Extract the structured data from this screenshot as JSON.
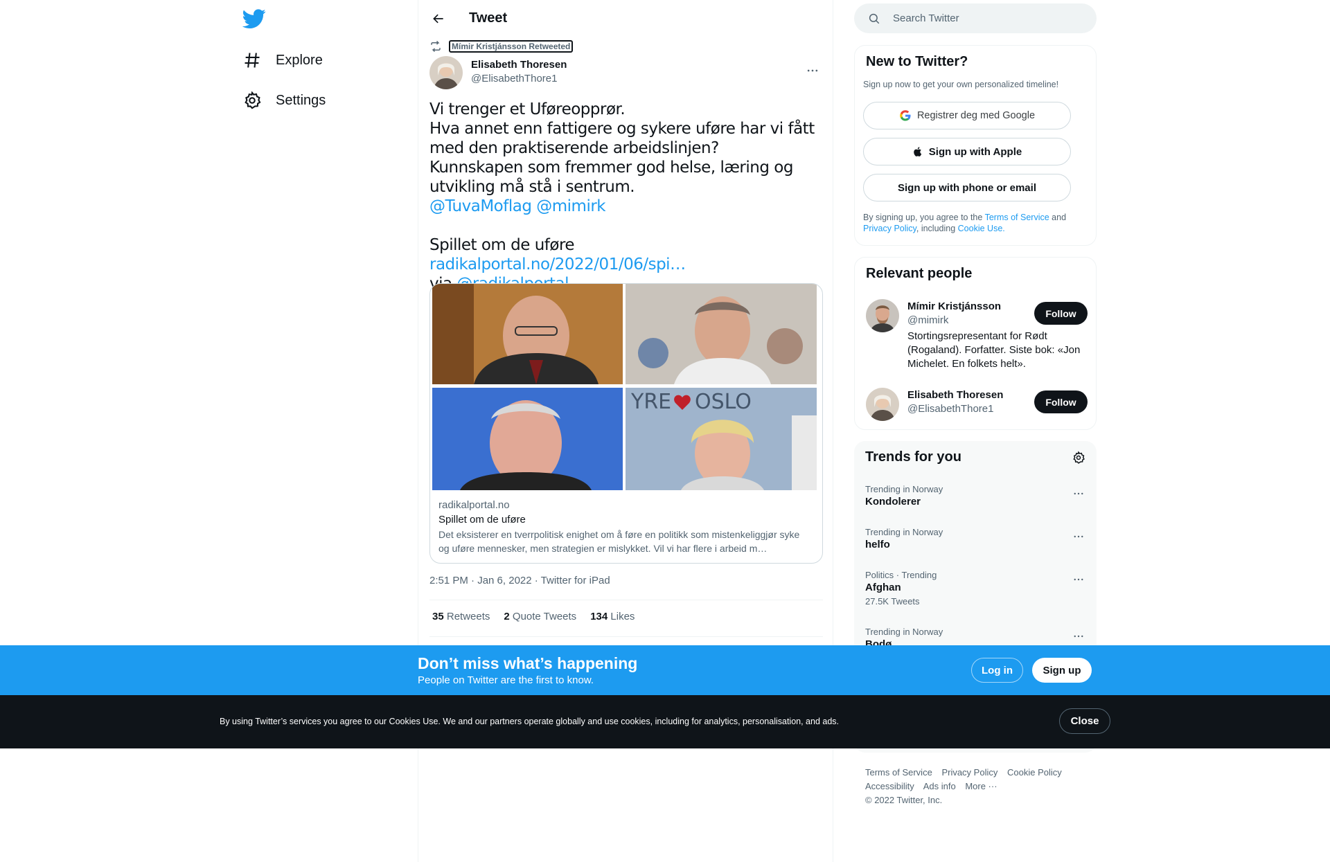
{
  "nav": {
    "items": [
      {
        "label": "Explore",
        "icon": "hashtag-icon"
      },
      {
        "label": "Settings",
        "icon": "gear-icon"
      }
    ]
  },
  "header": {
    "title": "Tweet"
  },
  "tweet": {
    "retweeted_by": "Mímir Kristjánsson Retweeted",
    "author_name": "Elisabeth Thoresen",
    "author_handle": "@ElisabethThore1",
    "text_line1": "Vi trenger et Uføreopprør.",
    "text_line2": "Hva annet enn fattigere og sykere uføre har vi fått med den praktiserende arbeidslinjen?",
    "text_line3": "Kunnskapen som fremmer god helse, læring og utvikling må stå i sentrum.",
    "mention1": "@TuvaMoflag",
    "mention2": "@mimirk",
    "text_article": "Spillet om de uføre",
    "link": "radikalportal.no/2022/01/06/spi…",
    "via": "via",
    "mention3": "@radikalportal",
    "card": {
      "domain": "radikalportal.no",
      "title": "Spillet om de uføre",
      "description": "Det eksisterer en tverrpolitisk enighet om å føre en politikk som mistenkeliggjør syke og uføre mennesker, men strategien er mislykket. Vil vi har flere i arbeid m…"
    },
    "time": "2:51 PM · Jan 6, 2022",
    "app": "Twitter for iPad",
    "stats": {
      "retweets_count": "35",
      "retweets_label": "Retweets",
      "quotes_count": "2",
      "quotes_label": "Quote Tweets",
      "likes_count": "134",
      "likes_label": "Likes"
    }
  },
  "search": {
    "placeholder": "Search Twitter"
  },
  "signup": {
    "title": "New to Twitter?",
    "subtitle": "Sign up now to get your own personalized timeline!",
    "google_label": "Registrer deg med Google",
    "apple_label": "Sign up with Apple",
    "phone_label": "Sign up with phone or email",
    "legal_prefix": "By signing up, you agree to the",
    "terms": "Terms of Service",
    "and": "and",
    "privacy": "Privacy Policy",
    "including": ", including",
    "cookie": "Cookie Use."
  },
  "relevant": {
    "title": "Relevant people",
    "people": [
      {
        "name": "Mímir Kristjánsson",
        "handle": "@mimirk",
        "bio": "Stortingsrepresentant for Rødt (Rogaland). Forfatter. Siste bok: «Jon Michelet. En folkets helt».",
        "follow": "Follow"
      },
      {
        "name": "Elisabeth Thoresen",
        "handle": "@ElisabethThore1",
        "bio": "",
        "follow": "Follow"
      }
    ]
  },
  "trends": {
    "title": "Trends for you",
    "items": [
      {
        "meta": "Trending in Norway",
        "name": "Kondolerer",
        "count": ""
      },
      {
        "meta": "Trending in Norway",
        "name": "helfo",
        "count": ""
      },
      {
        "meta": "Politics · Trending",
        "name": "Afghan",
        "count": "27.5K Tweets"
      },
      {
        "meta": "Trending in Norway",
        "name": "Bodø",
        "count": ""
      }
    ]
  },
  "footer": {
    "links": [
      "Terms of Service",
      "Privacy Policy",
      "Cookie Policy",
      "Accessibility",
      "Ads info",
      "More ···"
    ],
    "copyright": "© 2022 Twitter, Inc."
  },
  "banner": {
    "title": "Don’t miss what’s happening",
    "subtitle": "People on Twitter are the first to know.",
    "login": "Log in",
    "signup": "Sign up"
  },
  "cookie_bar": {
    "text": "By using Twitter’s services you agree to our Cookies Use. We and our partners operate globally and use cookies, including for analytics, personalisation, and ads.",
    "close": "Close"
  },
  "colors": {
    "accent": "#1d9bf0",
    "text": "#0f1419",
    "muted": "#536471",
    "dark": "#0f1419"
  }
}
